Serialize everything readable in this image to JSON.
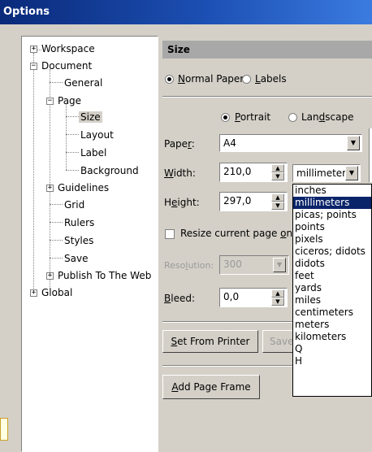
{
  "window": {
    "title": "Options"
  },
  "tree": {
    "workspace": "Workspace",
    "document": "Document",
    "general": "General",
    "page": "Page",
    "size": "Size",
    "layout": "Layout",
    "label": "Label",
    "background": "Background",
    "guidelines": "Guidelines",
    "grid": "Grid",
    "rulers": "Rulers",
    "styles": "Styles",
    "save": "Save",
    "publish": "Publish To The Web",
    "global": "Global"
  },
  "panel": {
    "header": "Size",
    "normal_paper": "ormal Paper",
    "normal_paper_key": "N",
    "labels": "abels",
    "labels_key": "L",
    "portrait": "ortrait",
    "portrait_key": "P",
    "landscape_pre": "Lan",
    "landscape_key": "d",
    "landscape_post": "scape",
    "paper_label_pre": "Pape",
    "paper_label_key": "r",
    "paper_label_post": ":",
    "paper_value": "A4",
    "width_label_key": "W",
    "width_label_post": "idth:",
    "width_value": "210,0",
    "units_value": "millimeters",
    "height_label_pre": "H",
    "height_label_key": "e",
    "height_label_post": "ight:",
    "height_value": "297,0",
    "resize_pre": "Resize current page ",
    "resize_key": "o",
    "resize_post": "nly",
    "resolution_label_pre": "Reso",
    "resolution_label_key": "l",
    "resolution_label_post": "ution:",
    "resolution_value": "300",
    "bleed_label_key": "B",
    "bleed_label_post": "leed:",
    "bleed_value": "0,0",
    "set_from_printer_key": "S",
    "set_from_printer_post": "et From Printer",
    "save_button": "Save",
    "add_frame_key": "A",
    "add_frame_post": "dd Page Frame"
  },
  "units_options": [
    "inches",
    "millimeters",
    "picas; points",
    "points",
    "pixels",
    "ciceros; didots",
    "didots",
    "feet",
    "yards",
    "miles",
    "centimeters",
    "meters",
    "kilometers",
    "Q",
    "H"
  ],
  "units_selected_index": 1,
  "colors": {
    "title_gradient_start": "#0a2a7a",
    "highlight": "#0a246a",
    "dialog_face": "#d4d0c8"
  }
}
